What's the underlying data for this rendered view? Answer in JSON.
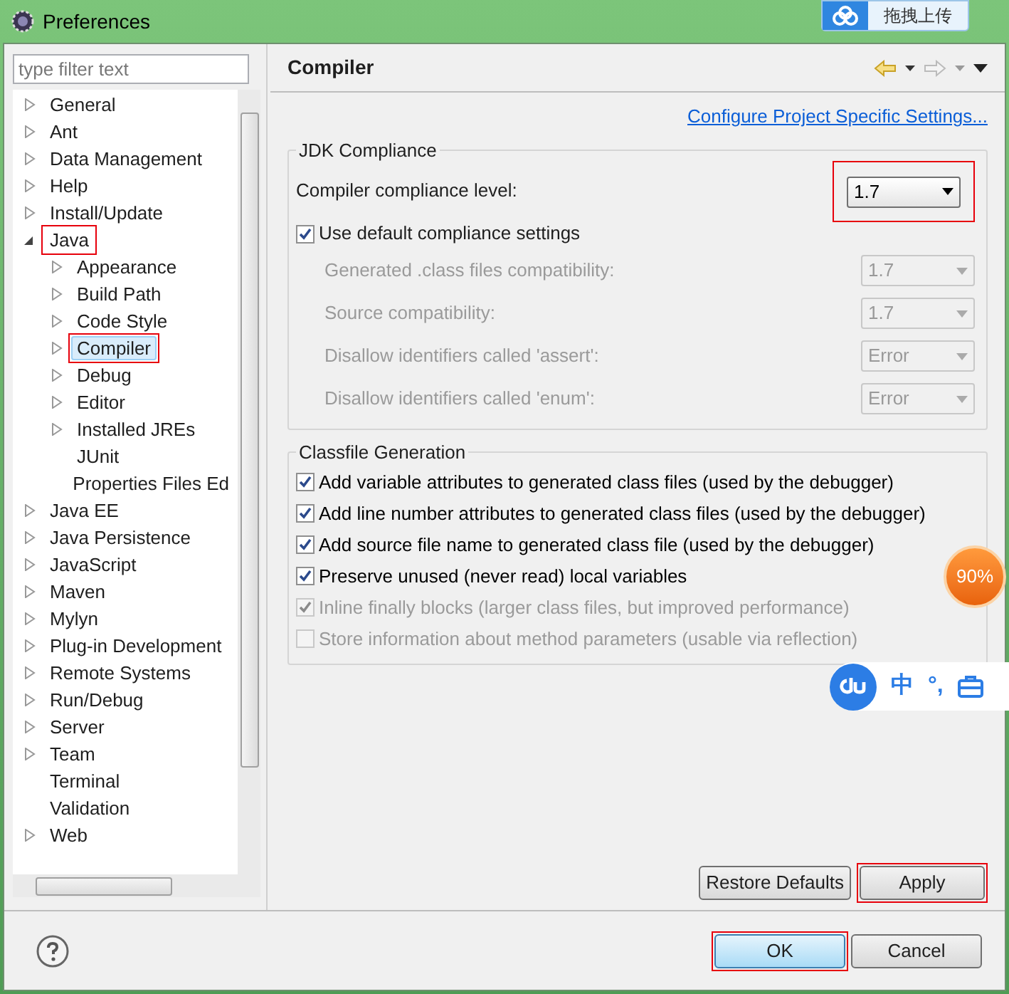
{
  "window": {
    "title": "Preferences"
  },
  "filter": {
    "placeholder": "type filter text"
  },
  "tree": [
    {
      "label": "General",
      "kind": "branch",
      "expanded": false,
      "selected": false
    },
    {
      "label": "Ant",
      "kind": "branch",
      "expanded": false,
      "selected": false
    },
    {
      "label": "Data Management",
      "kind": "branch",
      "expanded": false,
      "selected": false
    },
    {
      "label": "Help",
      "kind": "branch",
      "expanded": false,
      "selected": false
    },
    {
      "label": "Install/Update",
      "kind": "branch",
      "expanded": false,
      "selected": false
    },
    {
      "label": "Java",
      "kind": "branch",
      "expanded": true,
      "selected": false,
      "marked": true,
      "children": [
        {
          "label": "Appearance",
          "kind": "branch",
          "expanded": false,
          "selected": false
        },
        {
          "label": "Build Path",
          "kind": "branch",
          "expanded": false,
          "selected": false
        },
        {
          "label": "Code Style",
          "kind": "branch",
          "expanded": false,
          "selected": false
        },
        {
          "label": "Compiler",
          "kind": "branch",
          "expanded": false,
          "selected": true,
          "marked": true
        },
        {
          "label": "Debug",
          "kind": "branch",
          "expanded": false,
          "selected": false
        },
        {
          "label": "Editor",
          "kind": "branch",
          "expanded": false,
          "selected": false
        },
        {
          "label": "Installed JREs",
          "kind": "branch",
          "expanded": false,
          "selected": false
        },
        {
          "label": "JUnit",
          "kind": "leaf",
          "selected": false
        },
        {
          "label": "Properties Files Ed",
          "kind": "leaf",
          "selected": false
        }
      ]
    },
    {
      "label": "Java EE",
      "kind": "branch",
      "expanded": false,
      "selected": false
    },
    {
      "label": "Java Persistence",
      "kind": "branch",
      "expanded": false,
      "selected": false
    },
    {
      "label": "JavaScript",
      "kind": "branch",
      "expanded": false,
      "selected": false
    },
    {
      "label": "Maven",
      "kind": "branch",
      "expanded": false,
      "selected": false
    },
    {
      "label": "Mylyn",
      "kind": "branch",
      "expanded": false,
      "selected": false
    },
    {
      "label": "Plug-in Development",
      "kind": "branch",
      "expanded": false,
      "selected": false
    },
    {
      "label": "Remote Systems",
      "kind": "branch",
      "expanded": false,
      "selected": false
    },
    {
      "label": "Run/Debug",
      "kind": "branch",
      "expanded": false,
      "selected": false
    },
    {
      "label": "Server",
      "kind": "branch",
      "expanded": false,
      "selected": false
    },
    {
      "label": "Team",
      "kind": "branch",
      "expanded": false,
      "selected": false
    },
    {
      "label": "Terminal",
      "kind": "leaf",
      "selected": false
    },
    {
      "label": "Validation",
      "kind": "leaf",
      "selected": false
    },
    {
      "label": "Web",
      "kind": "branch",
      "expanded": false,
      "selected": false
    }
  ],
  "page": {
    "title": "Compiler",
    "link": "Configure Project Specific Settings..."
  },
  "jdk": {
    "title": "JDK Compliance",
    "compliance": {
      "label": "Compiler compliance level:",
      "value": "1.7",
      "marked": true
    },
    "use_default": {
      "label": "Use default compliance settings",
      "checked": true
    },
    "rows": [
      {
        "label": "Generated .class files compatibility:",
        "value": "1.7",
        "disabled": true
      },
      {
        "label": "Source compatibility:",
        "value": "1.7",
        "disabled": true
      },
      {
        "label": "Disallow identifiers called 'assert':",
        "value": "Error",
        "disabled": true
      },
      {
        "label": "Disallow identifiers called 'enum':",
        "value": "Error",
        "disabled": true
      }
    ]
  },
  "classfile": {
    "title": "Classfile Generation",
    "options": [
      {
        "label": "Add variable attributes to generated class files (used by the debugger)",
        "checked": true,
        "disabled": false
      },
      {
        "label": "Add line number attributes to generated class files (used by the debugger)",
        "checked": true,
        "disabled": false
      },
      {
        "label": "Add source file name to generated class file (used by the debugger)",
        "checked": true,
        "disabled": false
      },
      {
        "label": "Preserve unused (never read) local variables",
        "checked": true,
        "disabled": false
      },
      {
        "label": "Inline finally blocks (larger class files, but improved performance)",
        "checked": true,
        "disabled": true
      },
      {
        "label": "Store information about method parameters (usable via reflection)",
        "checked": false,
        "disabled": true
      }
    ]
  },
  "page_buttons": [
    {
      "label": "Restore Defaults",
      "marked": false
    },
    {
      "label": "Apply",
      "marked": true
    }
  ],
  "dialog_buttons": [
    {
      "label": "OK",
      "default": true,
      "marked": true
    },
    {
      "label": "Cancel",
      "default": false,
      "marked": false
    }
  ],
  "overlays": {
    "upload_label": "拖拽上传",
    "progress": "90%",
    "ime": [
      "中",
      "°,"
    ]
  }
}
